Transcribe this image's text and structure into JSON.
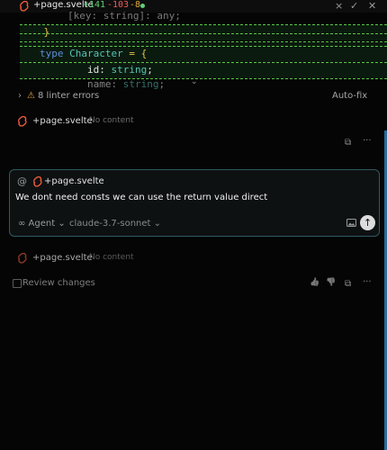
{
  "file_header": {
    "file_name": "+page.svelte",
    "additions": "+141",
    "removals": "-103",
    "modified": "-8",
    "close_icon": "×",
    "accept_icon": "✓",
    "reject_icon": "✕",
    "colors": {
      "add": "#5fd07a",
      "remove": "#ef5b5b",
      "modify": "#e4a63a"
    }
  },
  "code_lines": [
    {
      "indent": "        ",
      "text": "[key: string]: any;"
    },
    {
      "indent": "    ",
      "text": "}"
    },
    {
      "indent": "",
      "text": ""
    },
    {
      "keyword": "type",
      "type_name": "Character",
      "punct": "= {"
    },
    {
      "indent": "        ",
      "prop": "id",
      "type": "string",
      "end": ";"
    },
    {
      "indent": "        ",
      "prop": "name",
      "type": "string",
      "end": ";"
    }
  ],
  "linter": {
    "chevron": "›",
    "warning_icon": "⚠",
    "label": "8 linter errors",
    "autofix_label": "Auto-fix"
  },
  "previous_file": {
    "name": "+page.svelte",
    "note": "No content"
  },
  "message_actions": {
    "copy_icon": "⧉",
    "more_icon": "···"
  },
  "composer": {
    "at_symbol": "@",
    "context_file": "+page.svelte",
    "message": "We dont need consts we can use the return value direct",
    "mode_icon": "∞",
    "mode_label": "Agent",
    "mode_chevron": "⌄",
    "model_label": "claude-3.7-sonnet",
    "model_chevron": "⌄",
    "send_icon": "↑"
  },
  "pending_file": {
    "name": "+page.svelte",
    "note": "No content"
  },
  "review": {
    "label": "Review changes",
    "thumbs_up": "👍",
    "thumbs_down": "👎"
  }
}
